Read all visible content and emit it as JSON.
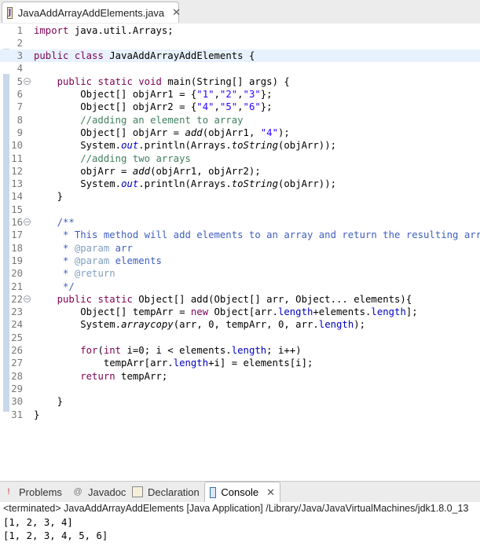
{
  "editor_tab": {
    "title": "JavaAddArrayAddElements.java",
    "icon": "java-file-icon",
    "close_glyph": "✕"
  },
  "code_lines": [
    {
      "num": "1",
      "tokens": [
        {
          "t": "import",
          "c": "kw"
        },
        {
          "t": " java.util.Arrays;",
          "c": ""
        }
      ]
    },
    {
      "num": "2",
      "tokens": []
    },
    {
      "num": "3",
      "current": true,
      "tokens": [
        {
          "t": "public",
          "c": "kw"
        },
        {
          "t": " ",
          "c": ""
        },
        {
          "t": "class",
          "c": "kw"
        },
        {
          "t": " JavaAddArrayAddElements {",
          "c": ""
        }
      ]
    },
    {
      "num": "4",
      "tokens": []
    },
    {
      "num": "5",
      "fold": true,
      "tokens": [
        {
          "t": "    ",
          "c": ""
        },
        {
          "t": "public",
          "c": "kw"
        },
        {
          "t": " ",
          "c": ""
        },
        {
          "t": "static",
          "c": "kw"
        },
        {
          "t": " ",
          "c": ""
        },
        {
          "t": "void",
          "c": "kw"
        },
        {
          "t": " main(String[] args) {",
          "c": ""
        }
      ]
    },
    {
      "num": "6",
      "tokens": [
        {
          "t": "        Object[] objArr1 = {",
          "c": ""
        },
        {
          "t": "\"1\"",
          "c": "str"
        },
        {
          "t": ",",
          "c": ""
        },
        {
          "t": "\"2\"",
          "c": "str"
        },
        {
          "t": ",",
          "c": ""
        },
        {
          "t": "\"3\"",
          "c": "str"
        },
        {
          "t": "};",
          "c": ""
        }
      ]
    },
    {
      "num": "7",
      "tokens": [
        {
          "t": "        Object[] objArr2 = {",
          "c": ""
        },
        {
          "t": "\"4\"",
          "c": "str"
        },
        {
          "t": ",",
          "c": ""
        },
        {
          "t": "\"5\"",
          "c": "str"
        },
        {
          "t": ",",
          "c": ""
        },
        {
          "t": "\"6\"",
          "c": "str"
        },
        {
          "t": "};",
          "c": ""
        }
      ]
    },
    {
      "num": "8",
      "tokens": [
        {
          "t": "        //adding an element to array",
          "c": "cmt"
        }
      ]
    },
    {
      "num": "9",
      "tokens": [
        {
          "t": "        Object[] objArr = ",
          "c": ""
        },
        {
          "t": "add",
          "c": "ital"
        },
        {
          "t": "(objArr1, ",
          "c": ""
        },
        {
          "t": "\"4\"",
          "c": "str"
        },
        {
          "t": ");",
          "c": ""
        }
      ]
    },
    {
      "num": "10",
      "tokens": [
        {
          "t": "        System.",
          "c": ""
        },
        {
          "t": "out",
          "c": "field-ital"
        },
        {
          "t": ".println(Arrays.",
          "c": ""
        },
        {
          "t": "toString",
          "c": "ital"
        },
        {
          "t": "(objArr));",
          "c": ""
        }
      ]
    },
    {
      "num": "11",
      "tokens": [
        {
          "t": "        //adding two arrays",
          "c": "cmt"
        }
      ]
    },
    {
      "num": "12",
      "tokens": [
        {
          "t": "        objArr = ",
          "c": ""
        },
        {
          "t": "add",
          "c": "ital"
        },
        {
          "t": "(objArr1, objArr2);",
          "c": ""
        }
      ]
    },
    {
      "num": "13",
      "tokens": [
        {
          "t": "        System.",
          "c": ""
        },
        {
          "t": "out",
          "c": "field-ital"
        },
        {
          "t": ".println(Arrays.",
          "c": ""
        },
        {
          "t": "toString",
          "c": "ital"
        },
        {
          "t": "(objArr));",
          "c": ""
        }
      ]
    },
    {
      "num": "14",
      "tokens": [
        {
          "t": "    }",
          "c": ""
        }
      ]
    },
    {
      "num": "15",
      "tokens": []
    },
    {
      "num": "16",
      "fold": true,
      "tokens": [
        {
          "t": "    /**",
          "c": "jd"
        }
      ]
    },
    {
      "num": "17",
      "tokens": [
        {
          "t": "     * This method will add elements to an array and return the resulting array",
          "c": "jd"
        }
      ]
    },
    {
      "num": "18",
      "tokens": [
        {
          "t": "     * ",
          "c": "jd"
        },
        {
          "t": "@param",
          "c": "jdtag"
        },
        {
          "t": " arr",
          "c": "jd"
        }
      ]
    },
    {
      "num": "19",
      "tokens": [
        {
          "t": "     * ",
          "c": "jd"
        },
        {
          "t": "@param",
          "c": "jdtag"
        },
        {
          "t": " elements",
          "c": "jd"
        }
      ]
    },
    {
      "num": "20",
      "tokens": [
        {
          "t": "     * ",
          "c": "jd"
        },
        {
          "t": "@return",
          "c": "jdtag"
        }
      ]
    },
    {
      "num": "21",
      "tokens": [
        {
          "t": "     */",
          "c": "jd"
        }
      ]
    },
    {
      "num": "22",
      "fold": true,
      "tokens": [
        {
          "t": "    ",
          "c": ""
        },
        {
          "t": "public",
          "c": "kw"
        },
        {
          "t": " ",
          "c": ""
        },
        {
          "t": "static",
          "c": "kw"
        },
        {
          "t": " Object[] add(Object[] arr, Object... elements){",
          "c": ""
        }
      ]
    },
    {
      "num": "23",
      "tokens": [
        {
          "t": "        Object[] tempArr = ",
          "c": ""
        },
        {
          "t": "new",
          "c": "kw"
        },
        {
          "t": " Object[arr.",
          "c": ""
        },
        {
          "t": "length",
          "c": "field"
        },
        {
          "t": "+elements.",
          "c": ""
        },
        {
          "t": "length",
          "c": "field"
        },
        {
          "t": "];",
          "c": ""
        }
      ]
    },
    {
      "num": "24",
      "tokens": [
        {
          "t": "        System.",
          "c": ""
        },
        {
          "t": "arraycopy",
          "c": "ital"
        },
        {
          "t": "(arr, 0, tempArr, 0, arr.",
          "c": ""
        },
        {
          "t": "length",
          "c": "field"
        },
        {
          "t": ");",
          "c": ""
        }
      ]
    },
    {
      "num": "25",
      "tokens": []
    },
    {
      "num": "26",
      "tokens": [
        {
          "t": "        ",
          "c": ""
        },
        {
          "t": "for",
          "c": "kw"
        },
        {
          "t": "(",
          "c": ""
        },
        {
          "t": "int",
          "c": "kw"
        },
        {
          "t": " i=0; i < elements.",
          "c": ""
        },
        {
          "t": "length",
          "c": "field"
        },
        {
          "t": "; i++)",
          "c": ""
        }
      ]
    },
    {
      "num": "27",
      "tokens": [
        {
          "t": "            tempArr[arr.",
          "c": ""
        },
        {
          "t": "length",
          "c": "field"
        },
        {
          "t": "+i] = elements[i];",
          "c": ""
        }
      ]
    },
    {
      "num": "28",
      "tokens": [
        {
          "t": "        ",
          "c": ""
        },
        {
          "t": "return",
          "c": "kw"
        },
        {
          "t": " tempArr;",
          "c": ""
        }
      ]
    },
    {
      "num": "29",
      "tokens": []
    },
    {
      "num": "30",
      "tokens": [
        {
          "t": "    }",
          "c": ""
        }
      ]
    },
    {
      "num": "31",
      "tokens": [
        {
          "t": "}",
          "c": ""
        }
      ]
    }
  ],
  "views": {
    "problems": "Problems",
    "javadoc": "Javadoc",
    "declaration": "Declaration",
    "console": "Console",
    "console_close_glyph": "✕"
  },
  "console": {
    "header": "<terminated> JavaAddArrayAddElements [Java Application] /Library/Java/JavaVirtualMachines/jdk1.8.0_13",
    "lines": [
      "[1, 2, 3, 4]",
      "[1, 2, 3, 4, 5, 6]"
    ]
  },
  "colors": {
    "keyword": "#7f0055",
    "string": "#2a00ff",
    "comment": "#3f7f5f",
    "javadoc": "#3f5fbf",
    "current_line": "#e8f2fe"
  }
}
